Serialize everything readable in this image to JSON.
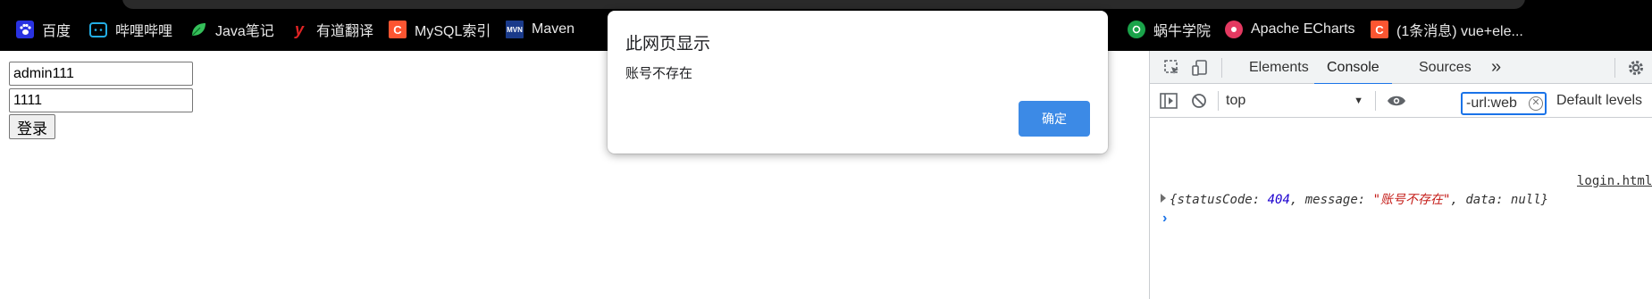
{
  "bookmarks": [
    {
      "label": "百度",
      "icon": "baidu-icon"
    },
    {
      "label": "哔哩哔哩",
      "icon": "bilibili-icon"
    },
    {
      "label": "Java笔记",
      "icon": "leaf-icon"
    },
    {
      "label": "有道翻译",
      "icon": "youdao-icon"
    },
    {
      "label": "MySQL索引",
      "icon": "csdn-icon",
      "glyph": "C"
    },
    {
      "label": "Maven",
      "icon": "maven-icon",
      "glyph": "MVN"
    },
    {
      "label": "蜗牛学院",
      "icon": "snail-icon"
    },
    {
      "label": "Apache ECharts",
      "icon": "echarts-icon"
    },
    {
      "label": "(1条消息) vue+ele...",
      "icon": "csdn-icon",
      "glyph": "C"
    }
  ],
  "login": {
    "username_value": "admin111",
    "password_value": "1111",
    "submit_label": "登录"
  },
  "dialog": {
    "title": "此网页显示",
    "message": "账号不存在",
    "ok_label": "确定"
  },
  "devtools": {
    "tabs": [
      "Elements",
      "Console",
      "Sources"
    ],
    "active_tab": "Console",
    "more_tabs_glyph": "»",
    "context": "top",
    "filter_value": "-url:web",
    "levels_label": "Default levels",
    "log": {
      "source": "login.html",
      "open": "{",
      "k1": "statusCode",
      "v1": "404",
      "k2": "message",
      "v2": "\"账号不存在\"",
      "k3": "data",
      "v3": "null",
      "close": "}",
      "sep": ": ",
      "comma": ", "
    },
    "prompt_glyph": "›"
  },
  "colors": {
    "accent": "#1a73e8",
    "dialog_button": "#3c8ae6",
    "bookmark_bar": "#000000"
  }
}
